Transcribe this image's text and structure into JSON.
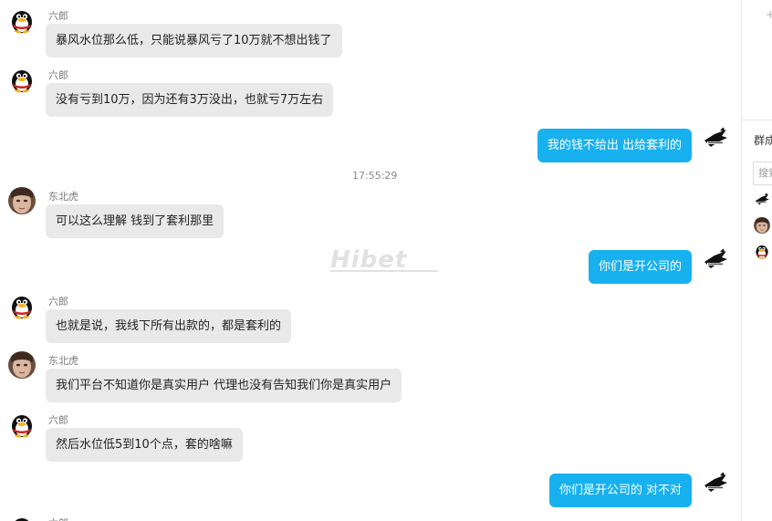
{
  "chat": {
    "timestamp": "17:55:29",
    "messages": [
      {
        "sender": "六郎",
        "direction": "in",
        "text": "暴风水位那么低，只能说暴风亏了10万就不想出钱了"
      },
      {
        "sender": "六郎",
        "direction": "in",
        "text": "没有亏到10万，因为还有3万没出，也就亏7万左右"
      },
      {
        "sender": "",
        "direction": "out",
        "text": "我的钱不给出 出给套利的"
      },
      {
        "sender": "东北虎",
        "direction": "in",
        "text": "可以这么理解 钱到了套利那里"
      },
      {
        "sender": "",
        "direction": "out",
        "text": "你们是开公司的"
      },
      {
        "sender": "六郎",
        "direction": "in",
        "text": "也就是说，我线下所有出款的，都是套利的"
      },
      {
        "sender": "东北虎",
        "direction": "in",
        "text": "我们平台不知道你是真实用户 代理也没有告知我们你是真实用户"
      },
      {
        "sender": "六郎",
        "direction": "in",
        "text": "然后水位低5到10个点，套的啥嘛"
      },
      {
        "sender": "",
        "direction": "out",
        "text": "你们是开公司的   对不对"
      },
      {
        "sender": "六郎",
        "direction": "in",
        "text": ""
      }
    ]
  },
  "watermark": "Hibet",
  "side_panel": {
    "title": "群成",
    "search_placeholder": "搜索"
  },
  "colors": {
    "incoming_bubble": "#e9e9e9",
    "outgoing_bubble": "#18b1ef",
    "sender_name": "#7a7a7a"
  },
  "icons": {
    "qq_penguin": "penguin-avatar-icon",
    "tiger": "tiger-avatar-icon",
    "self": "self-avatar-icon"
  }
}
